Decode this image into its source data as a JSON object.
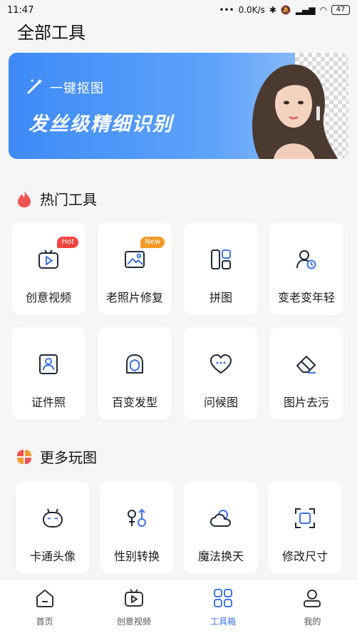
{
  "status_bar": {
    "time": "11:47",
    "speed": "0.0K/s",
    "battery": "47"
  },
  "page_title": "全部工具",
  "banner": {
    "subtitle": "一键抠图",
    "title": "发丝级精细识别"
  },
  "hot_section": {
    "title": "热门工具",
    "tools": [
      {
        "label": "创意视频",
        "badge": "Hot",
        "icon": "video-icon"
      },
      {
        "label": "老照片修复",
        "badge": "New",
        "icon": "photo-icon"
      },
      {
        "label": "拼图",
        "badge": "",
        "icon": "collage-icon"
      },
      {
        "label": "变老变年轻",
        "badge": "",
        "icon": "age-icon"
      },
      {
        "label": "证件照",
        "badge": "",
        "icon": "id-photo-icon"
      },
      {
        "label": "百变发型",
        "badge": "",
        "icon": "hairstyle-icon"
      },
      {
        "label": "问候图",
        "badge": "",
        "icon": "heart-icon"
      },
      {
        "label": "图片去污",
        "badge": "",
        "icon": "eraser-icon"
      }
    ]
  },
  "more_section": {
    "title": "更多玩图",
    "tools": [
      {
        "label": "卡通头像",
        "icon": "cartoon-icon"
      },
      {
        "label": "性别转换",
        "icon": "gender-icon"
      },
      {
        "label": "魔法换天",
        "icon": "weather-icon"
      },
      {
        "label": "修改尺寸",
        "icon": "resize-icon"
      }
    ]
  },
  "tabs": [
    {
      "label": "首页",
      "active": false
    },
    {
      "label": "创意视频",
      "active": false
    },
    {
      "label": "工具箱",
      "active": true
    },
    {
      "label": "我的",
      "active": false
    }
  ],
  "colors": {
    "accent": "#3f73e8",
    "icon_dark": "#1f2937",
    "hot": "#f0453f",
    "new": "#f39a28"
  }
}
